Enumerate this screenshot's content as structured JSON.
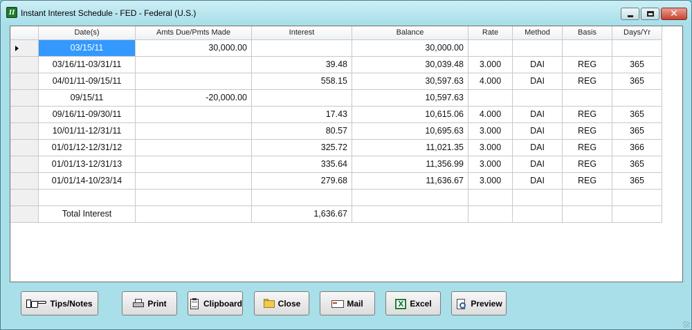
{
  "window": {
    "title": "Instant Interest Schedule - FED - Federal (U.S.)",
    "close_glyph": "✕"
  },
  "grid": {
    "columns": [
      "Date(s)",
      "Amts Due/Pmts Made",
      "Interest",
      "Balance",
      "Rate",
      "Method",
      "Basis",
      "Days/Yr"
    ],
    "rows": [
      [
        "03/15/11",
        "30,000.00",
        "",
        "30,000.00",
        "",
        "",
        "",
        ""
      ],
      [
        "03/16/11-03/31/11",
        "",
        "39.48",
        "30,039.48",
        "3.000",
        "DAI",
        "REG",
        "365"
      ],
      [
        "04/01/11-09/15/11",
        "",
        "558.15",
        "30,597.63",
        "4.000",
        "DAI",
        "REG",
        "365"
      ],
      [
        "09/15/11",
        "-20,000.00",
        "",
        "10,597.63",
        "",
        "",
        "",
        ""
      ],
      [
        "09/16/11-09/30/11",
        "",
        "17.43",
        "10,615.06",
        "4.000",
        "DAI",
        "REG",
        "365"
      ],
      [
        "10/01/11-12/31/11",
        "",
        "80.57",
        "10,695.63",
        "3.000",
        "DAI",
        "REG",
        "365"
      ],
      [
        "01/01/12-12/31/12",
        "",
        "325.72",
        "11,021.35",
        "3.000",
        "DAI",
        "REG",
        "366"
      ],
      [
        "01/01/13-12/31/13",
        "",
        "335.64",
        "11,356.99",
        "3.000",
        "DAI",
        "REG",
        "365"
      ],
      [
        "01/01/14-10/23/14",
        "",
        "279.68",
        "11,636.67",
        "3.000",
        "DAI",
        "REG",
        "365"
      ],
      [
        "",
        "",
        "",
        "",
        "",
        "",
        "",
        ""
      ],
      [
        "Total Interest",
        "",
        "1,636.67",
        "",
        "",
        "",
        "",
        ""
      ]
    ]
  },
  "buttons": {
    "tips": "Tips/Notes",
    "print": "Print",
    "clipboard": "Clipboard",
    "close": "Close",
    "mail": "Mail",
    "excel": "Excel",
    "preview": "Preview"
  },
  "icons": {
    "app": "app-icon",
    "tips": "pointing-hand-icon",
    "print": "printer-icon",
    "clipboard": "clipboard-icon",
    "close": "folder-icon",
    "mail": "envelope-icon",
    "excel": "excel-icon",
    "preview": "preview-magnifier-icon",
    "excel_letter": "X",
    "app_letter": "II"
  },
  "colors": {
    "window_bg": "#a8dfe9",
    "selection": "#3399ff",
    "close_button": "#c8432f"
  }
}
